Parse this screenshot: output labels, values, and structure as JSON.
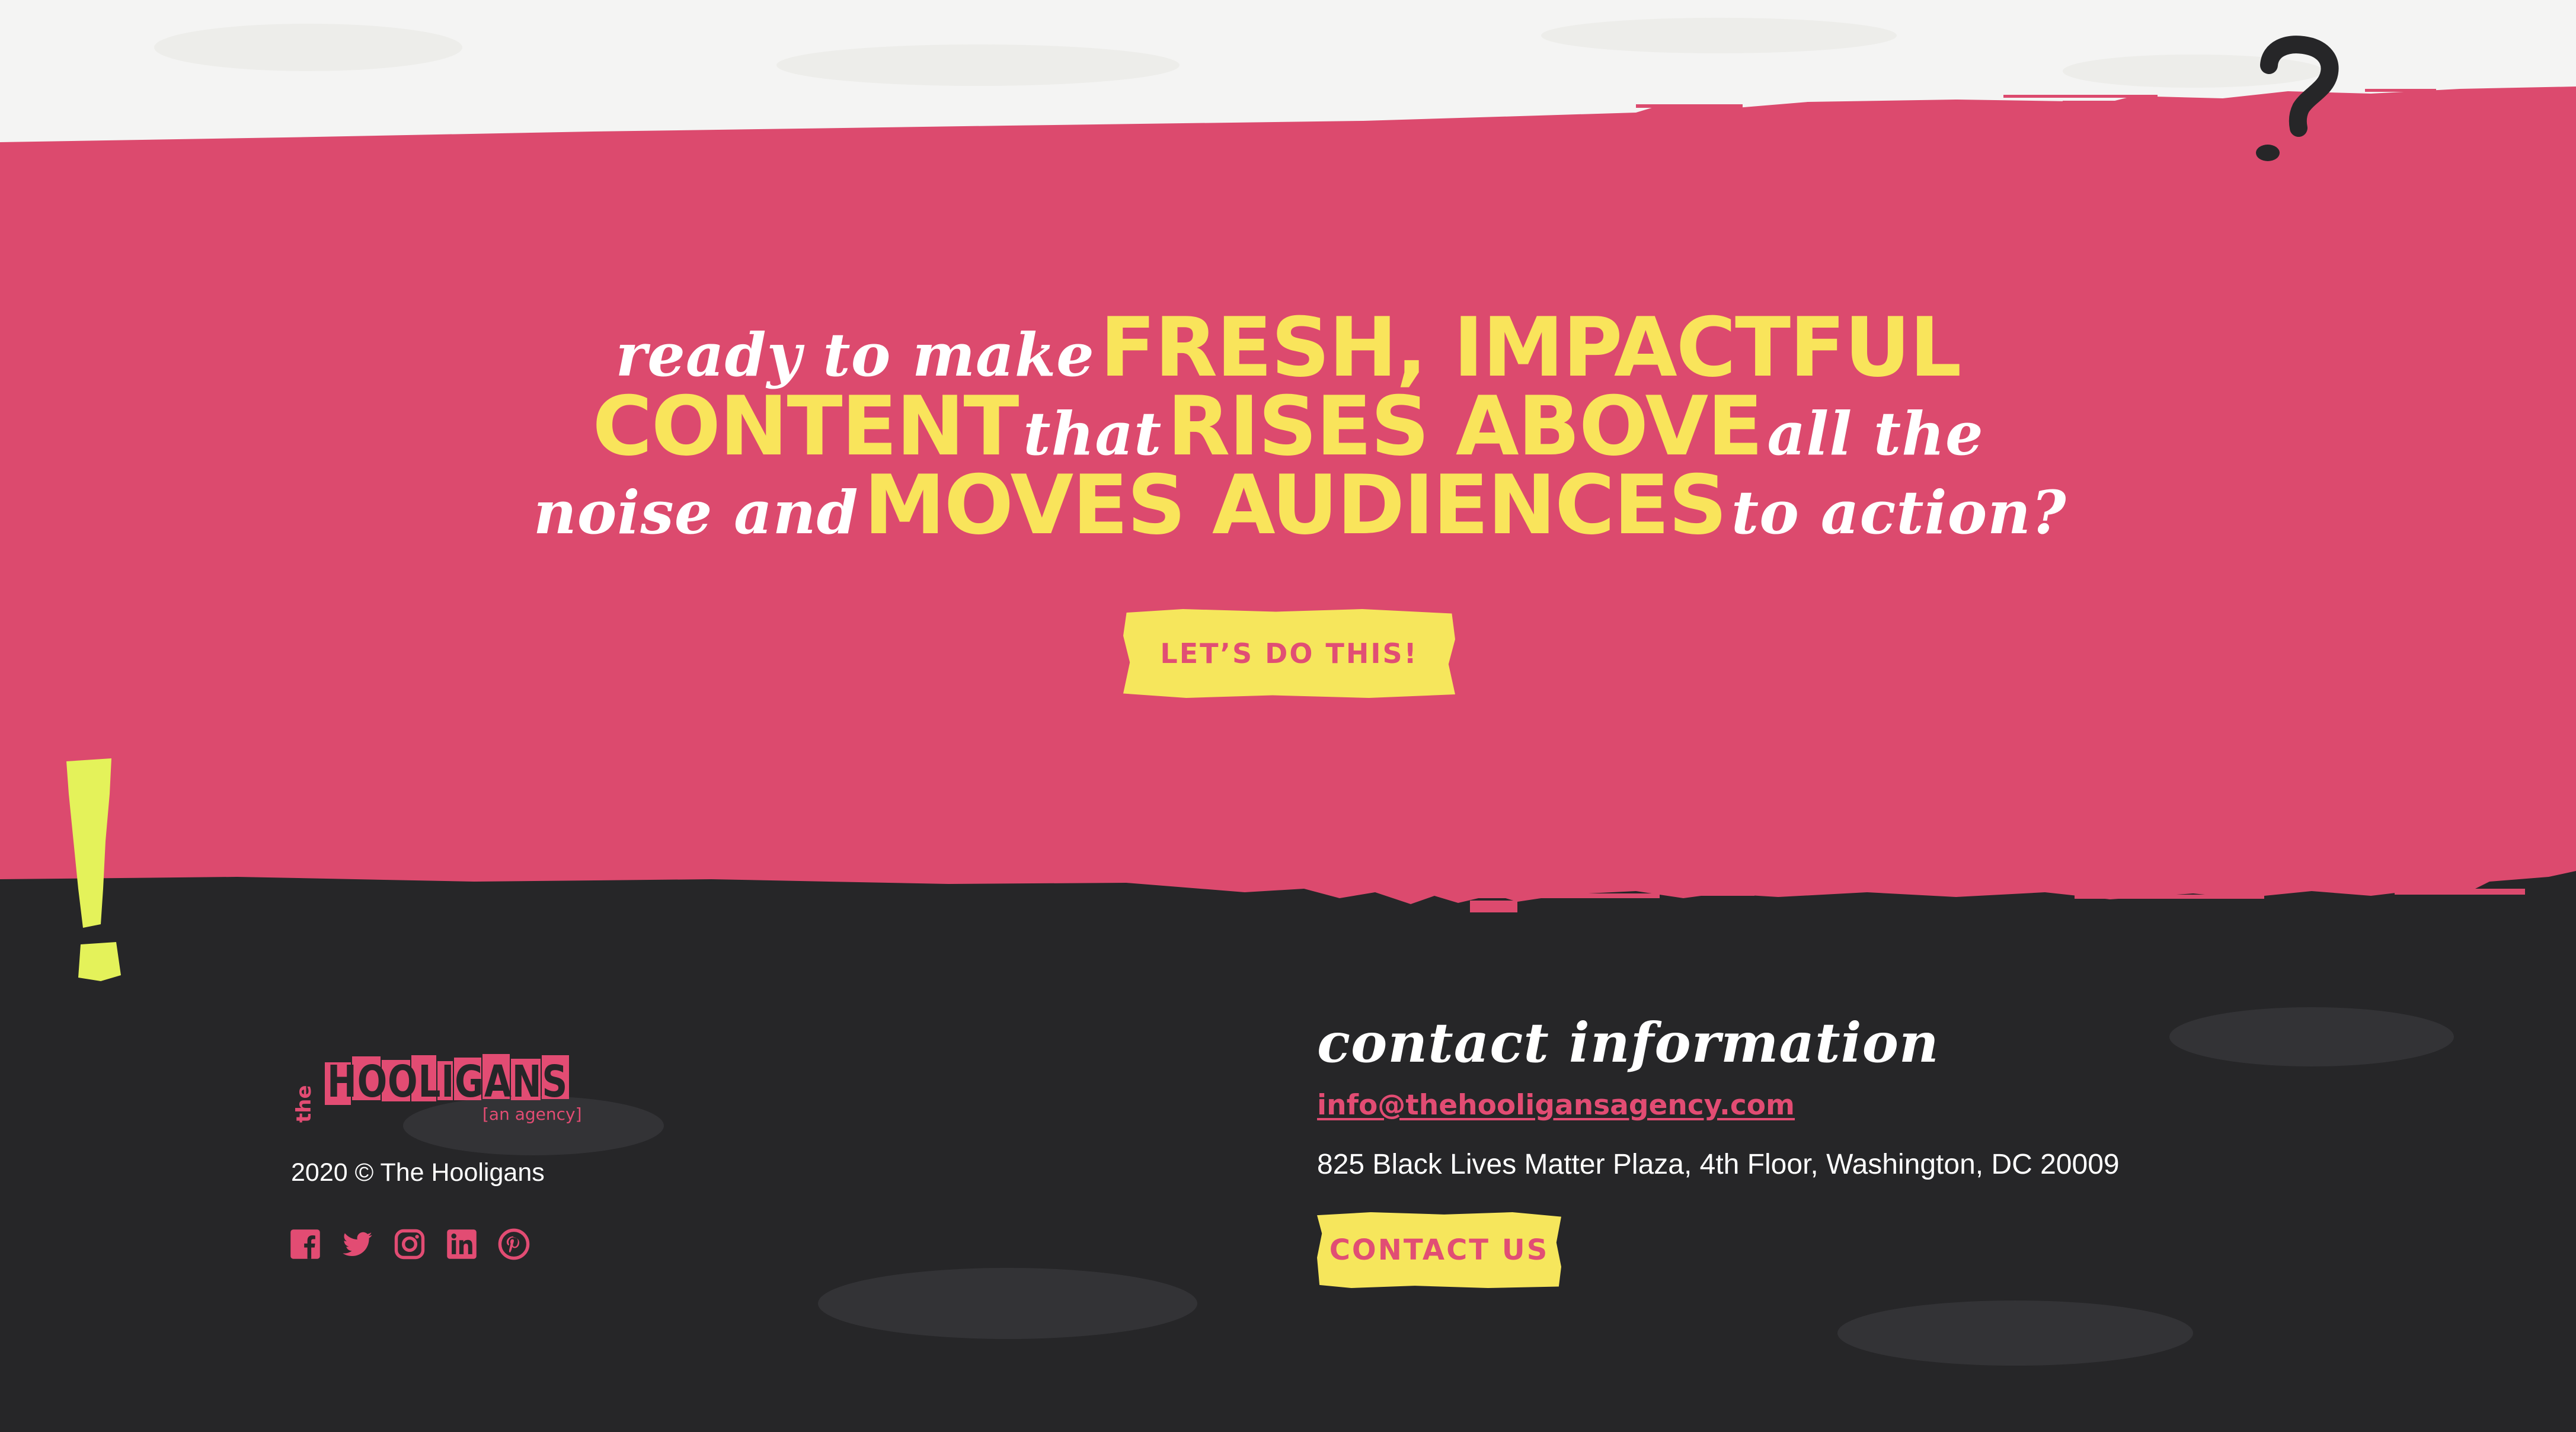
{
  "colors": {
    "pink": "#dc4a6e",
    "yellow": "#f9e45b",
    "dark": "#262628",
    "white": "#ffffff",
    "lime": "#e4f25a"
  },
  "hero": {
    "line1": {
      "script": "ready to make",
      "bold": "FRESH, IMPACTFUL"
    },
    "line2": {
      "bold_a": "CONTENT",
      "script_a": "that",
      "bold_b": "RISES ABOVE",
      "script_b": "all the"
    },
    "line3": {
      "script_a": "noise and",
      "bold": "MOVES AUDIENCES",
      "script_b": "to action?"
    },
    "cta_label": "LET’S DO THIS!"
  },
  "decorations": {
    "question_mark": "?",
    "exclamation_mark": "!"
  },
  "footer": {
    "logo": {
      "small": "the",
      "main": "HOOLIGANS",
      "tagline": "[an agency]"
    },
    "copyright": "2020 © The Hooligans",
    "social": [
      "facebook-icon",
      "twitter-icon",
      "instagram-icon",
      "linkedin-icon",
      "pinterest-icon"
    ],
    "contact": {
      "heading": "contact information",
      "email": "info@thehooligansagency.com",
      "address": "825 Black Lives Matter Plaza, 4th Floor, Washington, DC 20009",
      "button_label": "CONTACT US"
    }
  }
}
